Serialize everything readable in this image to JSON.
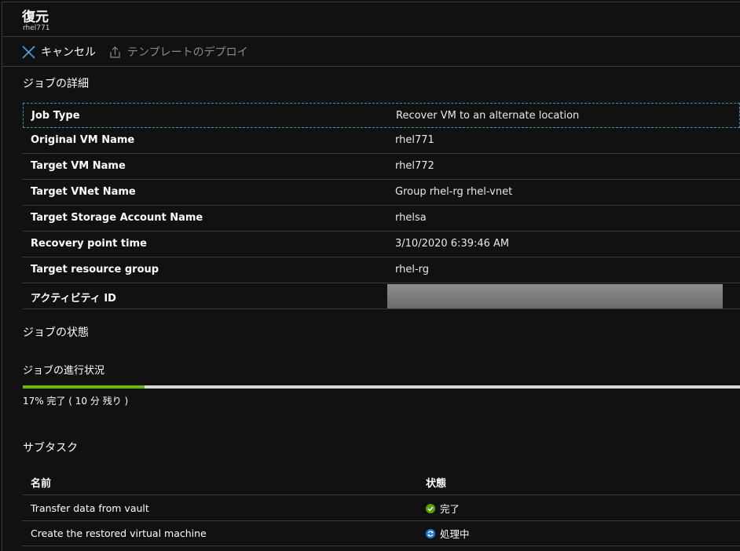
{
  "header": {
    "title": "復元",
    "subtitle": "rhel771"
  },
  "toolbar": {
    "cancel_label": "キャンセル",
    "deploy_label": "テンプレートのデプロイ"
  },
  "details": {
    "heading": "ジョブの詳細",
    "rows": [
      {
        "key": "Job Type",
        "value": "Recover VM to an alternate location"
      },
      {
        "key": "Original VM Name",
        "value": "rhel771"
      },
      {
        "key": "Target VM Name",
        "value": "rhel772"
      },
      {
        "key": "Target VNet Name",
        "value": "Group rhel-rg rhel-vnet"
      },
      {
        "key": "Target Storage Account Name",
        "value": "rhelsa"
      },
      {
        "key": "Recovery point time",
        "value": "3/10/2020 6:39:46 AM"
      },
      {
        "key": "Target resource group",
        "value": "rhel-rg"
      },
      {
        "key": "アクティビティ ID",
        "value": ""
      }
    ]
  },
  "status": {
    "heading": "ジョブの状態"
  },
  "progress": {
    "heading": "ジョブの進行状況",
    "percent": 17,
    "text": "17% 完了 ( 10 分 残り )",
    "color": "#6bb700"
  },
  "subtasks": {
    "heading": "サブタスク",
    "col_name": "名前",
    "col_status": "状態",
    "rows": [
      {
        "name": "Transfer data from vault",
        "status": "完了",
        "icon": "check-circle-icon"
      },
      {
        "name": "Create the restored virtual machine",
        "status": "処理中",
        "icon": "sync-icon"
      }
    ]
  }
}
